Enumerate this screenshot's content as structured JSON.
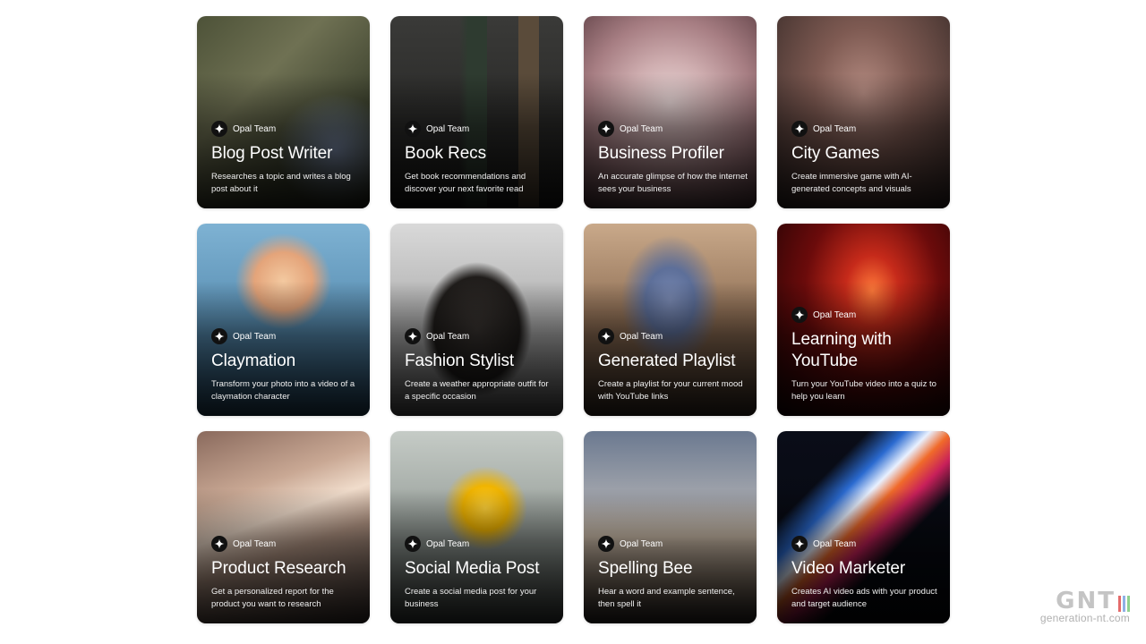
{
  "cards": [
    {
      "author": "Opal Team",
      "title": "Blog Post Writer",
      "description": "Researches a topic and writes a blog post about it",
      "icon": "laptop-blog-illustration",
      "bg": "radial-gradient(ellipse at 80% 70%, #7a8aa8 0%, rgba(0,0,0,0) 30%), linear-gradient(135deg, #4d5238 0%, #6f7153 35%, #3f4430 70%, #2b2f22 100%)"
    },
    {
      "author": "Opal Team",
      "title": "Book Recs",
      "description": "Get book recommendations and discover your next favorite read",
      "icon": "books-illustration",
      "bg": "linear-gradient(90deg, rgba(0,0,0,0) 40%, #2e3b30 45%, #2e3b30 56%, rgba(0,0,0,0) 56%, rgba(0,0,0,0) 74%, #5a4b3a 74%, #5a4b3a 86%, rgba(0,0,0,0) 86%), linear-gradient(180deg, #3a3a38 0%, #1d1d1c 100%)"
    },
    {
      "author": "Opal Team",
      "title": "Business Profiler",
      "description": "An accurate glimpse of how the internet sees your business",
      "icon": "molecule-bulb-illustration",
      "bg": "radial-gradient(circle at 50% 45%, #e8d6d6 0%, #cfaeb0 30%, #a77e83 60%, #5c3e43 100%)"
    },
    {
      "author": "Opal Team",
      "title": "City Games",
      "description": "Create immersive game with AI-generated concepts and visuals",
      "icon": "city-illustration",
      "bg": "radial-gradient(ellipse at 50% 40%, #b38a80 0%, #7e5a52 40%, #3a2c29 100%)"
    },
    {
      "author": "Opal Team",
      "title": "Claymation",
      "description": "Transform your photo into a video of a claymation character",
      "icon": "clay-character-illustration",
      "bg": "radial-gradient(circle at 50% 30%, #f3c9a0 0%, #e4a47a 18%, rgba(0,0,0,0) 30%), linear-gradient(180deg, #7eb2d3 0%, #5a8fb3 50%, #2f5a7a 100%)"
    },
    {
      "author": "Opal Team",
      "title": "Fashion Stylist",
      "description": "Create a weather appropriate outfit for a specific occasion",
      "icon": "dress-illustration",
      "bg": "radial-gradient(ellipse at 50% 55%, #3a3532 0%, #1f1c1a 35%, rgba(0,0,0,0) 45%), linear-gradient(180deg, #d9d9d9 0%, #a8a8a8 60%, #6e6e6e 100%)"
    },
    {
      "author": "Opal Team",
      "title": "Generated Playlist",
      "description": "Create a playlist for your current mood with YouTube links",
      "icon": "music-note-illustration",
      "bg": "radial-gradient(ellipse at 50% 40%, #7a8ab3 0%, #5d6f99 20%, rgba(0,0,0,0) 40%), linear-gradient(180deg, #c9a98a 0%, #8f6f55 50%, #4a3a2e 100%)"
    },
    {
      "author": "Opal Team",
      "title": "Learning with YouTube",
      "description": "Turn your YouTube video into a quiz to help you learn",
      "icon": "question-mark-illustration",
      "bg": "radial-gradient(ellipse at 55% 35%, #ff7a3a 0%, #c62a1a 20%, #6b0b0b 50%, #1a0203 100%)"
    },
    {
      "author": "Opal Team",
      "title": "Product Research",
      "description": "Get a personalized report for the product you want to research",
      "icon": "prism-illustration",
      "bg": "linear-gradient(160deg, #8a6a5d 0%, #c9a894 30%, #f0dccb 45%, #b89a88 60%, #4a3e3a 100%)"
    },
    {
      "author": "Opal Team",
      "title": "Social Media Post",
      "description": "Create a social media post for your business",
      "icon": "flower-illustration",
      "bg": "radial-gradient(circle at 55% 40%, #ffd23a 0%, #f0b400 15%, rgba(0,0,0,0) 28%), linear-gradient(180deg, #c5cbc6 0%, #8e9691 60%, #4c524e 100%)"
    },
    {
      "author": "Opal Team",
      "title": "Spelling Bee",
      "description": "Hear a word and example sentence, then spell it",
      "icon": "abc-glass-illustration",
      "bg": "linear-gradient(180deg, #6b7990 0%, #a3a6ad 35%, #d9c8b4 55%, #8a7a6a 80%, #3c3632 100%)"
    },
    {
      "author": "Opal Team",
      "title": "Video Marketer",
      "description": "Creates AI video ads with your product and target audience",
      "icon": "screen-illustration",
      "bg": "linear-gradient(135deg, rgba(0,0,0,0) 25%, #2a6ad0 35%, #e8f0ff 42%, #f06a2a 48%, #c8205a 55%, rgba(0,0,0,0) 65%), linear-gradient(180deg, #0a0d18 0%, #05070d 100%)"
    }
  ],
  "watermark": {
    "logo": "GNT",
    "site": "generation-nt.com"
  }
}
